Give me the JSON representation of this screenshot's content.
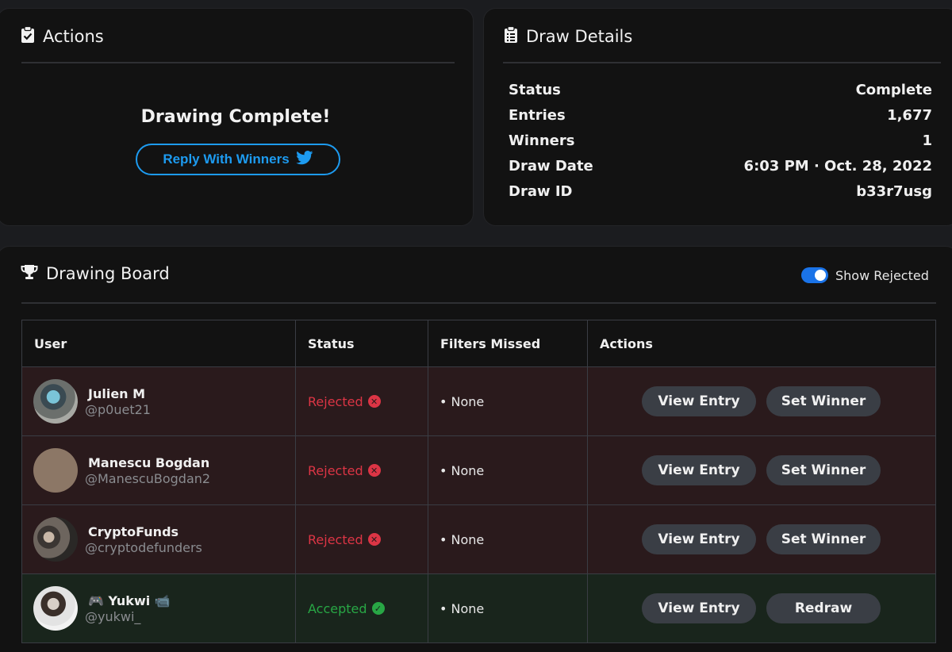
{
  "actions": {
    "title": "Actions",
    "complete_text": "Drawing Complete!",
    "reply_button": "Reply With Winners"
  },
  "details": {
    "title": "Draw Details",
    "rows": [
      {
        "label": "Status",
        "value": "Complete"
      },
      {
        "label": "Entries",
        "value": "1,677"
      },
      {
        "label": "Winners",
        "value": "1"
      },
      {
        "label": "Draw Date",
        "value": "6:03 PM · Oct. 28, 2022"
      },
      {
        "label": "Draw ID",
        "value": "b33r7usg"
      }
    ]
  },
  "board": {
    "title": "Drawing Board",
    "toggle_label": "Show Rejected",
    "toggle_on": true,
    "columns": [
      "User",
      "Status",
      "Filters Missed",
      "Actions"
    ],
    "rows": [
      {
        "name": "Julien M",
        "handle": "@p0uet21",
        "status": "Rejected",
        "filters": "• None",
        "btn1": "View Entry",
        "btn2": "Set Winner"
      },
      {
        "name": "Manescu Bogdan",
        "handle": "@ManescuBogdan2",
        "status": "Rejected",
        "filters": "• None",
        "btn1": "View Entry",
        "btn2": "Set Winner"
      },
      {
        "name": "CryptoFunds",
        "handle": "@cryptodefunders",
        "status": "Rejected",
        "filters": "• None",
        "btn1": "View Entry",
        "btn2": "Set Winner"
      },
      {
        "name": "🎮 Yukwi 📹",
        "handle": "@yukwi_",
        "status": "Accepted",
        "filters": "• None",
        "btn1": "View Entry",
        "btn2": "Redraw"
      }
    ]
  },
  "colors": {
    "twitter_blue": "#1d9bf0",
    "rejected": "#dc3545",
    "accepted": "#28a745",
    "toggle": "#1a73e8"
  }
}
